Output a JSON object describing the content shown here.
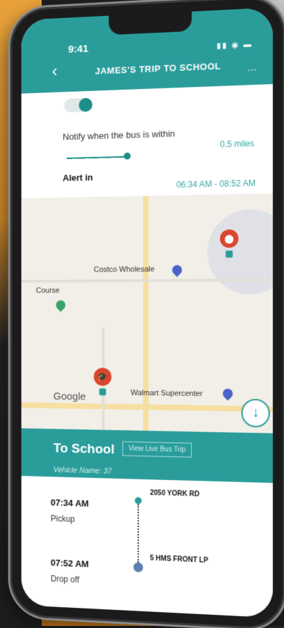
{
  "status_bar": {
    "time": "9:41",
    "icons": "signal wifi battery"
  },
  "header": {
    "title": "JAMES'S TRIP TO SCHOOL",
    "back_icon": "chevron-left-icon",
    "more_icon": "more-icon"
  },
  "notify": {
    "toggle_on": true,
    "label": "Notify when the bus is within",
    "distance": "0.5 miles",
    "alert_label": "Alert in",
    "alert_range": "06:34 AM - 08:52 AM"
  },
  "map": {
    "labels": {
      "costco": "Costco Wholesale",
      "course": "Course",
      "walmart": "Walmart Supercenter",
      "google": "Google"
    },
    "school_icon": "school-cap-icon"
  },
  "trip": {
    "title": "To School",
    "view_live": "View Live Bus Trip",
    "vehicle": "Vehicle Name: 37"
  },
  "stops": [
    {
      "time": "07:34 AM",
      "type": "Pickup",
      "address": "2050 YORK RD"
    },
    {
      "time": "07:52 AM",
      "type": "Drop off",
      "address": "5 HMS FRONT LP"
    }
  ],
  "colors": {
    "accent": "#2a9d9b",
    "school_pin": "#d8462e"
  }
}
